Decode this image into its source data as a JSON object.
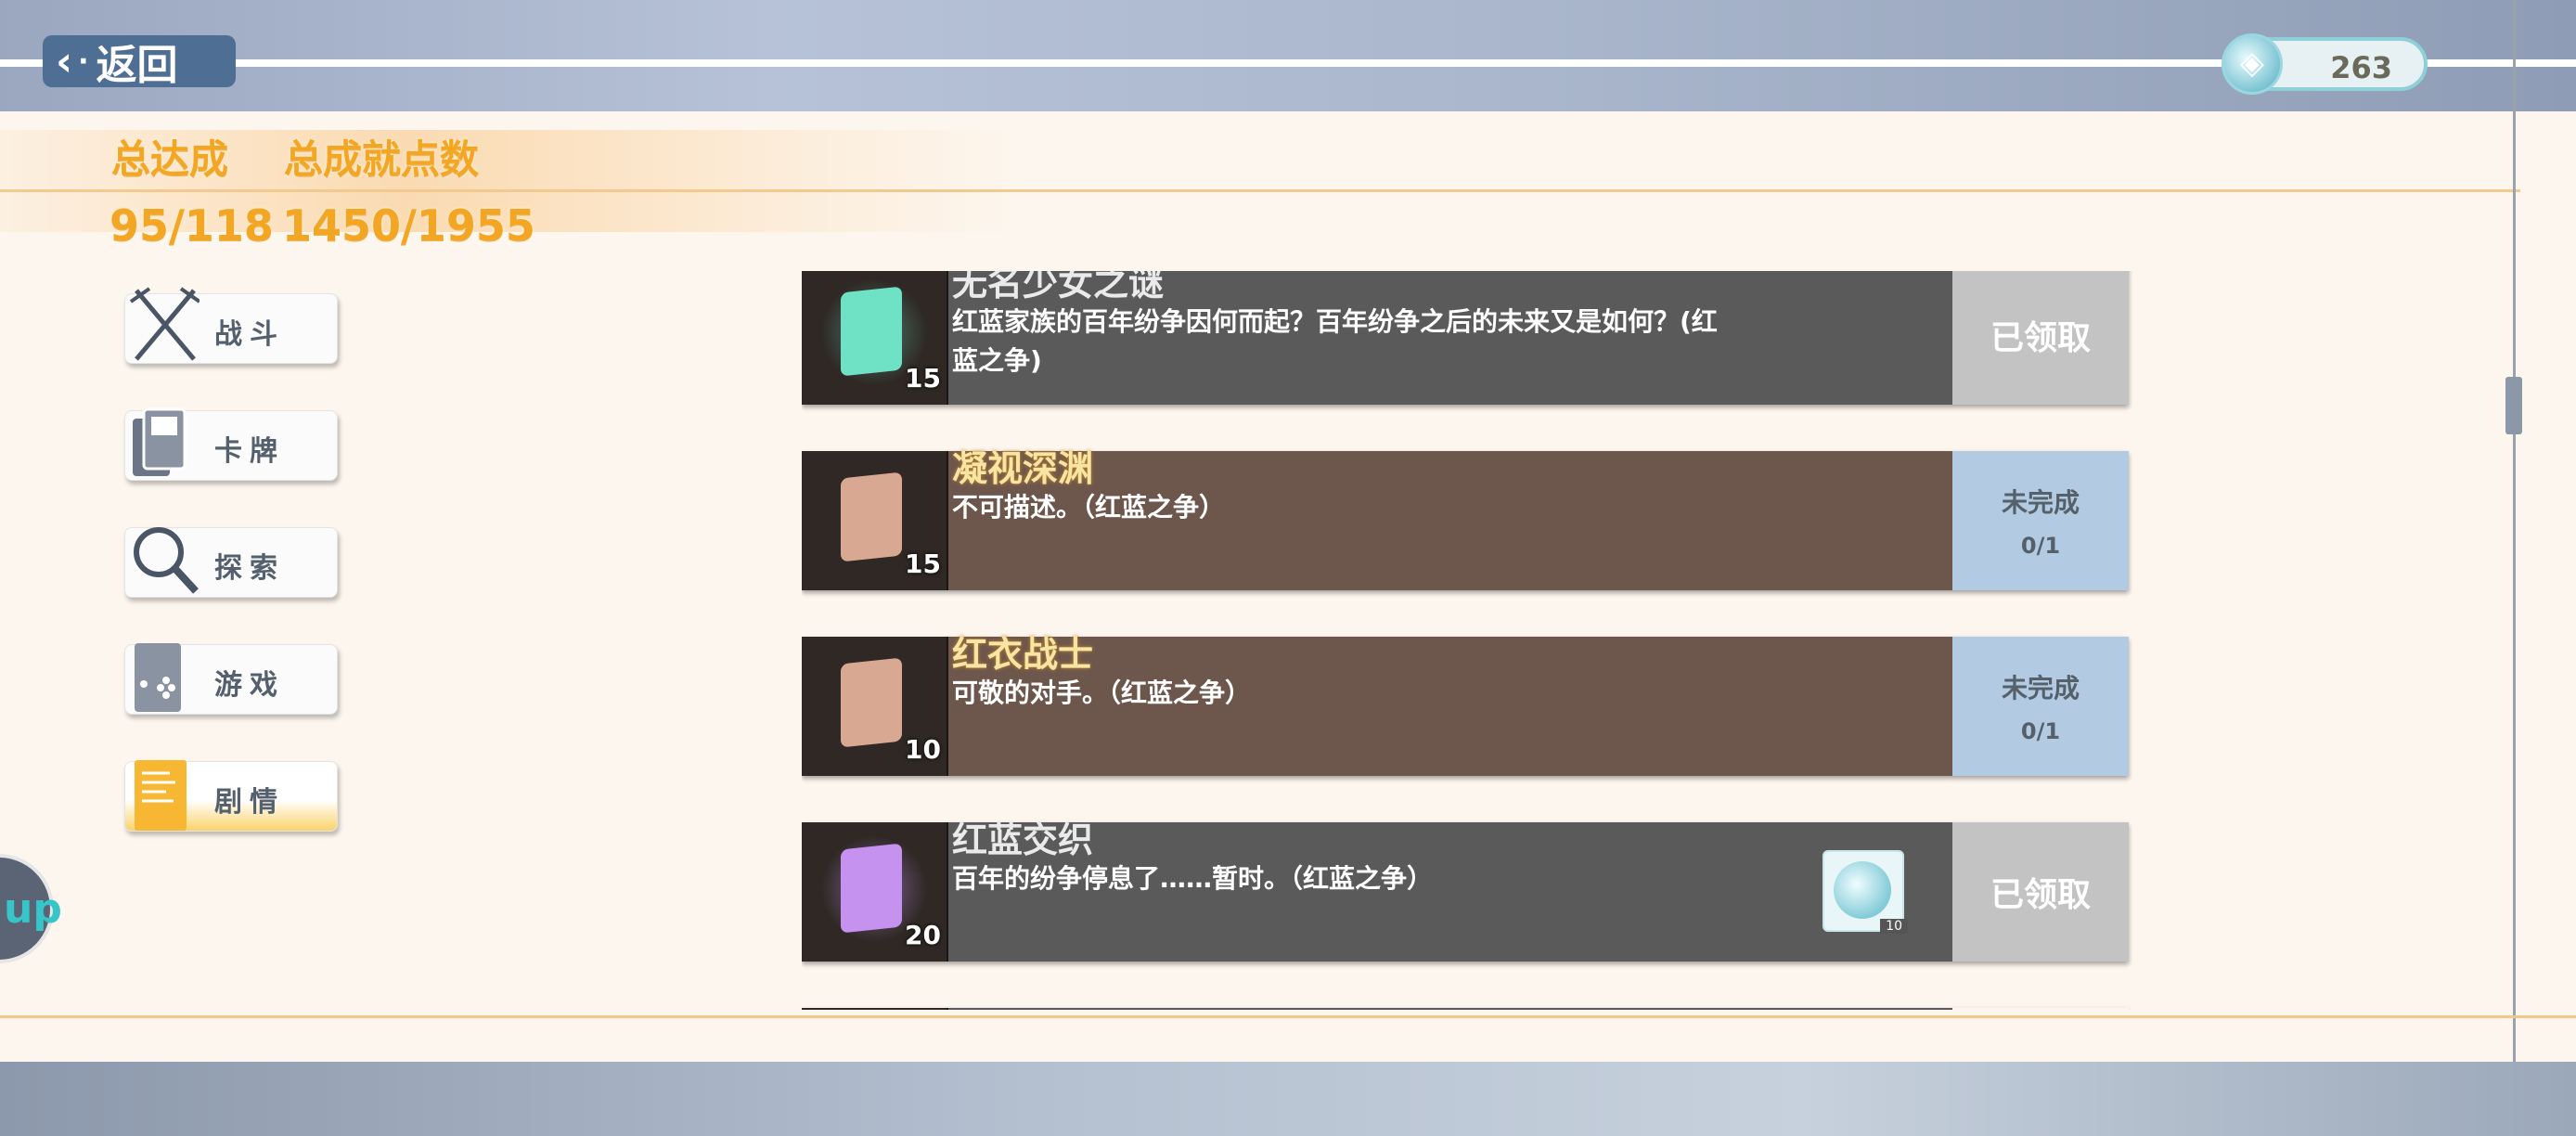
{
  "header": {
    "back_label": "返回",
    "currency_value": "263",
    "currency_icon": "gem-coin-icon"
  },
  "stats": {
    "total_label": "总达成",
    "points_label": "总成就点数",
    "total_value": "95/118",
    "points_value": "1450/1955"
  },
  "categories": [
    {
      "label": "战斗",
      "icon": "crossed-swords-icon"
    },
    {
      "label": "卡牌",
      "icon": "cards-icon"
    },
    {
      "label": "探索",
      "icon": "magnifier-icon"
    },
    {
      "label": "游戏",
      "icon": "gamepad-icon"
    },
    {
      "label": "剧情",
      "icon": "document-icon"
    }
  ],
  "side_tab": {
    "text": "up"
  },
  "achievements": [
    {
      "title": "无名少女之谜",
      "desc": "红蓝家族的百年纷争因何而起？百年纷争之后的未来又是如何？(红蓝之争)",
      "points": "15",
      "status": "已领取",
      "color": "#5a5a5a",
      "gem": "#6fe2c6"
    },
    {
      "title": "凝视深渊",
      "desc": "不可描述。（红蓝之争）",
      "points": "15",
      "status": "未完成",
      "progress": "0/1",
      "color": "#6d564c",
      "gem": "#d9a892"
    },
    {
      "title": "红衣战士",
      "desc": "可敬的对手。（红蓝之争）",
      "points": "10",
      "status": "未完成",
      "progress": "0/1",
      "color": "#6d564c",
      "gem": "#d9a892"
    },
    {
      "title": "红蓝交织",
      "desc": "百年的纷争停息了……暂时。（红蓝之争）",
      "points": "20",
      "status": "已领取",
      "color": "#5a5a5a",
      "gem": "#c592f0",
      "reward": "10"
    }
  ]
}
